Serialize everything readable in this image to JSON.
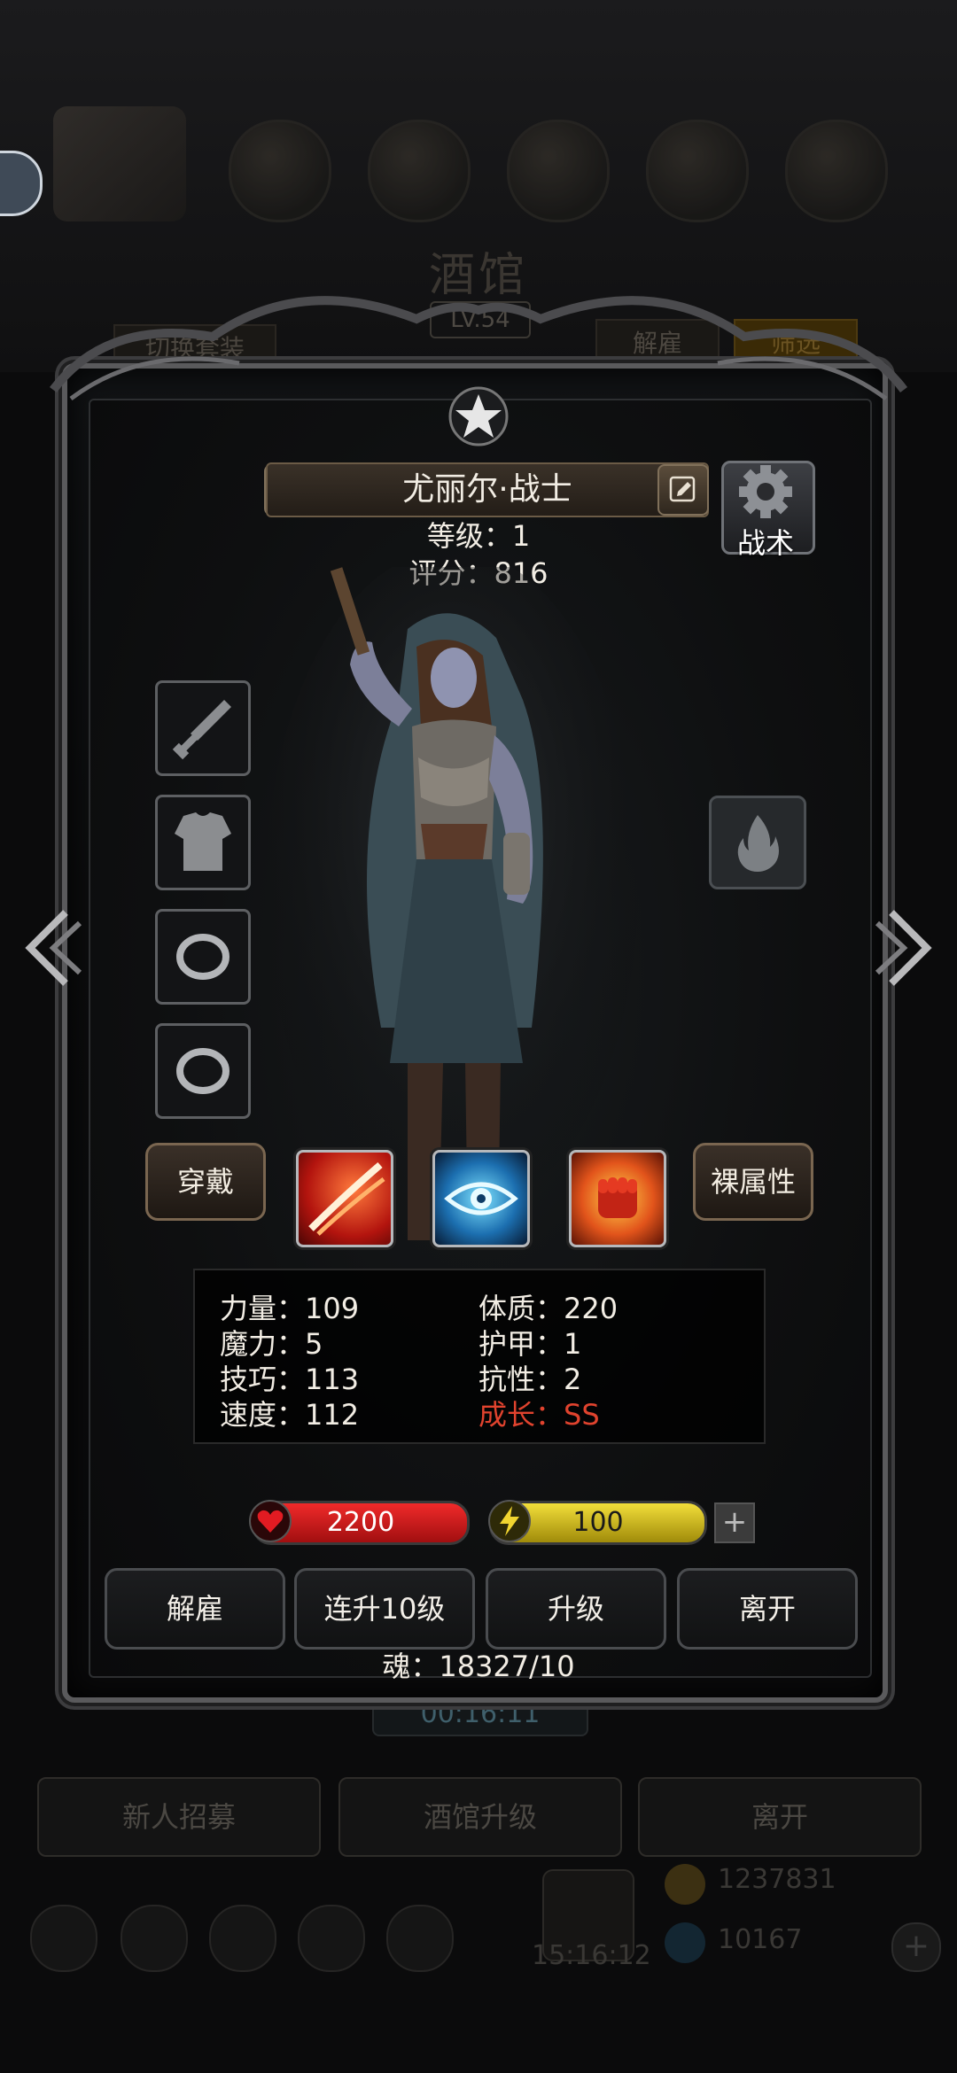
{
  "background": {
    "title": "酒馆",
    "level": "LV.54",
    "switch_outfit": "切换套装",
    "dismiss_tab": "解雇",
    "filter_tab": "筛选",
    "timer": "00:16:11",
    "bottom_buttons": [
      "新人招募",
      "酒馆升级",
      "离开"
    ],
    "gold": "1237831",
    "gems": "10167",
    "clock": "15:16:12"
  },
  "hero": {
    "name": "尤丽尔·战士",
    "level_text": "等级：1",
    "score_text": "评分：816",
    "tactics_label": "战术"
  },
  "equipment_slots": [
    {
      "icon": "sword-icon"
    },
    {
      "icon": "armor-icon"
    },
    {
      "icon": "ring-icon"
    },
    {
      "icon": "ring-icon"
    }
  ],
  "buttons": {
    "wear": "穿戴",
    "base_attributes": "裸属性"
  },
  "skills": [
    {
      "icon": "slash-skill-icon"
    },
    {
      "icon": "eye-skill-icon"
    },
    {
      "icon": "fist-skill-icon"
    }
  ],
  "stats": {
    "strength": "力量：109",
    "constitution": "体质：220",
    "magic": "魔力：5",
    "armor": "护甲：1",
    "skill": "技巧：113",
    "resistance": "抗性：2",
    "speed": "速度：112",
    "growth": "成长：SS"
  },
  "bars": {
    "hp": "2200",
    "energy": "100",
    "plus": "+"
  },
  "actions": [
    "解雇",
    "连升10级",
    "升级",
    "离开"
  ],
  "soul": "魂：18327/10",
  "colors": {
    "hp_bar": "#d8161c",
    "energy_bar": "#d8c21a",
    "growth_text": "#e0432e",
    "frame": "#5a5a5c"
  }
}
